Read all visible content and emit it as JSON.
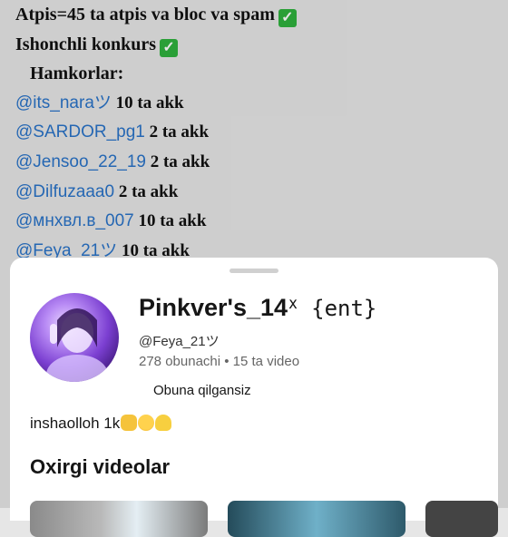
{
  "post": {
    "line1": {
      "text": "Atpis=45 ta atpis va bloc va spam"
    },
    "line2": {
      "text": "Ishonchli konkurs"
    },
    "line3": {
      "text": "Hamkorlar:"
    },
    "partners": [
      {
        "handle": "@its_naraツ",
        "count": " 10 ta  akk"
      },
      {
        "handle": "@SARDOR_pg1",
        "count": " 2 ta akk"
      },
      {
        "handle": "@Jensoo_22_19",
        "count": " 2 ta akk"
      },
      {
        "handle": "@Dilfuzaaa0",
        "count": " 2 ta akk"
      },
      {
        "handle": "@мнхвл.в_007",
        "count": " 10 ta akk"
      },
      {
        "handle": "@Feya_21ツ",
        "count": " 10 ta akk"
      }
    ],
    "check_icon": "green-check-emoji"
  },
  "profile": {
    "name": "Pinkver's_14",
    "name_tag": "ᕽ {ent}",
    "username": "@Feya_21ツ",
    "stats": "278 obunachi • 15 ta video",
    "subscribe_label": "Obuna qilgansiz",
    "bio": "inshaolloh 1k",
    "section_title": "Oxirgi videolar"
  }
}
